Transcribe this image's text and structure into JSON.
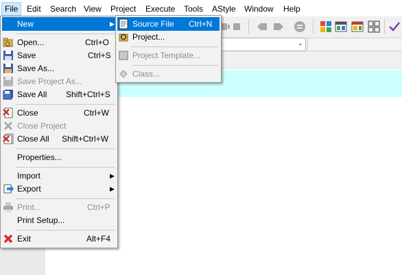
{
  "menubar": {
    "items": [
      "File",
      "Edit",
      "Search",
      "View",
      "Project",
      "Execute",
      "Tools",
      "AStyle",
      "Window",
      "Help"
    ]
  },
  "file_menu": {
    "new": "New",
    "open": "Open...",
    "open_sc": "Ctrl+O",
    "save": "Save",
    "save_sc": "Ctrl+S",
    "save_as": "Save As...",
    "save_project_as": "Save Project As...",
    "save_all": "Save All",
    "save_all_sc": "Shift+Ctrl+S",
    "close": "Close",
    "close_sc": "Ctrl+W",
    "close_project": "Close Project",
    "close_all": "Close All",
    "close_all_sc": "Shift+Ctrl+W",
    "properties": "Properties...",
    "import": "Import",
    "export": "Export",
    "print": "Print...",
    "print_sc": "Ctrl+P",
    "print_setup": "Print Setup...",
    "exit": "Exit",
    "exit_sc": "Alt+F4"
  },
  "new_submenu": {
    "source_file": "Source File",
    "source_file_sc": "Ctrl+N",
    "project": "Project...",
    "project_template": "Project Template...",
    "class": "Class..."
  },
  "colors": {
    "highlight": "#0078d7",
    "menubar_active": "#cce8ff",
    "editor_line": "#ccffff"
  }
}
